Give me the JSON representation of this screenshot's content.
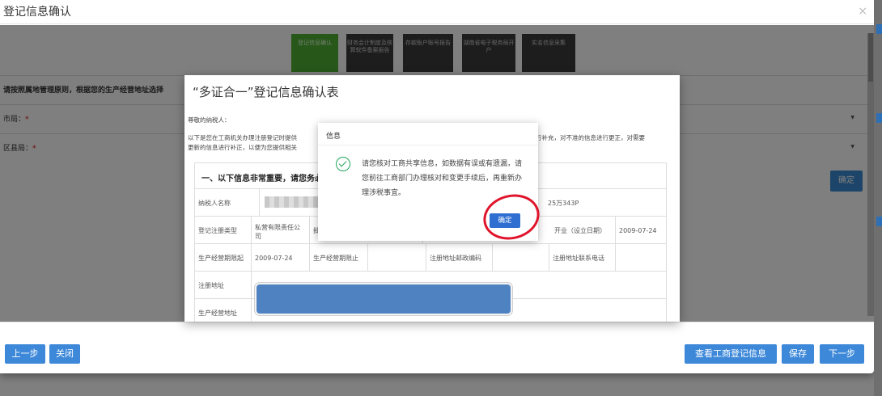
{
  "outer_modal": {
    "title": "登记信息确认",
    "close_glyph": "×"
  },
  "steps": [
    {
      "label": "登记信息确认"
    },
    {
      "label": "财务会计制度及核算软件备案报告"
    },
    {
      "label": "存款账户账号报告"
    },
    {
      "label": "湖南省电子税务局开户"
    },
    {
      "label": "实名信息采集"
    }
  ],
  "background_form": {
    "notice": "请按照属地管理原则，根据您的生产经营地址选择",
    "city_label": "市局：",
    "district_label": "区县局：",
    "required_mark": "*",
    "confirm_button": "确定"
  },
  "form_modal": {
    "title": "“多证合一”登记信息确认表",
    "greeting": "尊敬的纳税人：",
    "intro_line1_a": "以下是您在工商机关办理注册登记时提供",
    "intro_line1_b": "行补充，对不准的信息进行更正，对需要",
    "intro_line2": "更新的信息进行补正，以便为您提供相关",
    "section_title": "一、以下信息非常重要，请您务必",
    "rows": {
      "taxpayer_name_label": "纳税人名称",
      "taxpayer_id_tail": "25万343P",
      "reg_type_label": "登记注册类型",
      "reg_type_value": "私营有限责任公司",
      "approval_label_partial": "批准",
      "open_date_label": "开业（设立日期）",
      "open_date_value": "2009-07-24",
      "period_start_label": "生产经营期限起",
      "period_start_value": "2009-07-24",
      "period_end_label": "生产经营期限止",
      "postcode_label": "注册地址邮政编码",
      "reg_phone_label": "注册地址联系电话",
      "reg_address_label": "注册地址",
      "biz_address_label": "生产经营地址"
    }
  },
  "info_dialog": {
    "title": "信息",
    "message": "请您核对工商共享信息，如数据有误或有遗漏，请您前往工商部门办理核对和变更手续后，再重新办理涉税事宜。",
    "ok_button": "确定"
  },
  "footer": {
    "prev_button": "上一步",
    "close_button": "关闭",
    "view_info_button": "查看工商登记信息",
    "save_button": "保存",
    "next_button": "下一步"
  },
  "colors": {
    "primary_button": "#3d88d9",
    "active_step": "#4fae33",
    "inactive_step": "#3b3b3b",
    "success_icon": "#22a55b",
    "highlight_circle": "#e0142b"
  }
}
